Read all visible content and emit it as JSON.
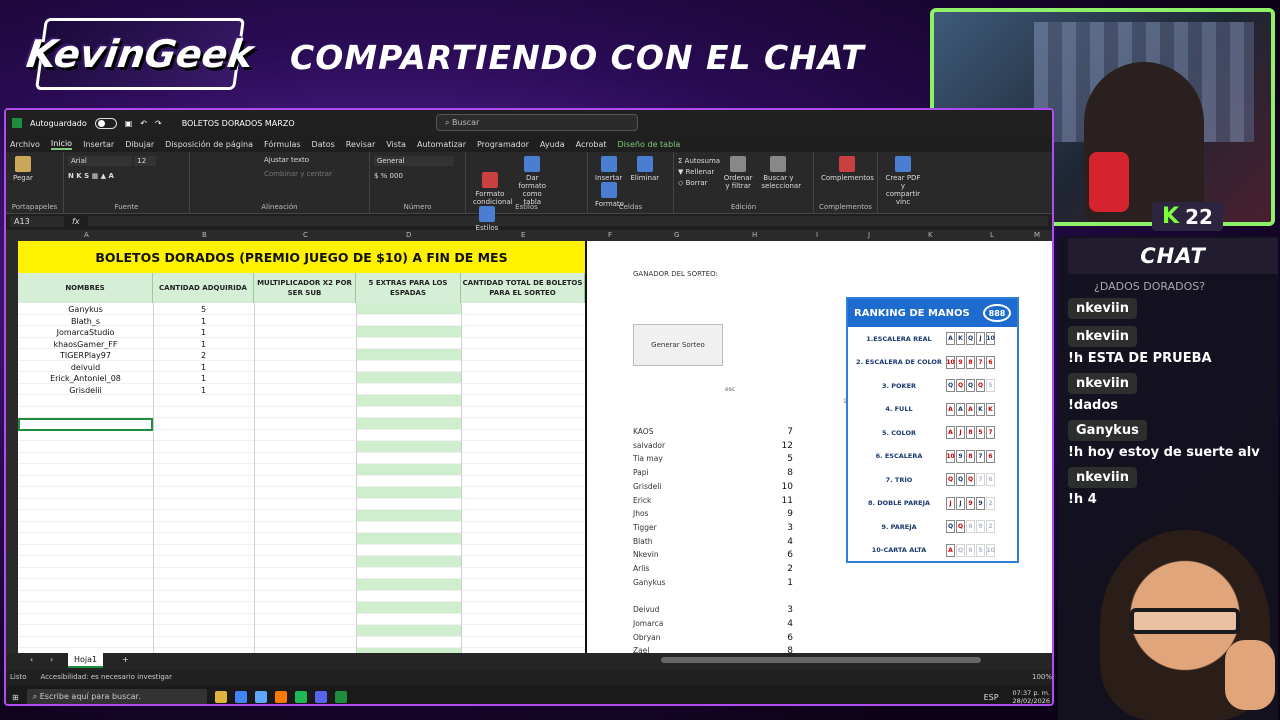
{
  "stream": {
    "logo_text": "KevinGeek",
    "title": "COMPARTIENDO CON EL CHAT",
    "viewers": "22",
    "chat_header": "CHAT"
  },
  "chat": [
    {
      "user": "nkeviin",
      "reply": "¿DADOS DORADOS?",
      "text": ""
    },
    {
      "user": "nkeviin",
      "reply": "",
      "text": "!h ESTA DE PRUEBA"
    },
    {
      "user": "nkeviin",
      "reply": "",
      "text": "!dados"
    },
    {
      "user": "Ganykus",
      "reply": "",
      "text": "!h hoy estoy de suerte alv"
    },
    {
      "user": "nkeviin",
      "reply": "",
      "text": "!h 4"
    }
  ],
  "excel": {
    "autosave": "Autoguardado",
    "filename": "BOLETOS DORADOS MARZO",
    "search": "Buscar",
    "menu": [
      "Archivo",
      "Inicio",
      "Insertar",
      "Dibujar",
      "Disposición de página",
      "Fórmulas",
      "Datos",
      "Revisar",
      "Vista",
      "Automatizar",
      "Programador",
      "Ayuda",
      "Acrobat",
      "Diseño de tabla"
    ],
    "ribbon": {
      "pegar": "Pegar",
      "portapapeles": "Portapapeles",
      "font": "Arial",
      "size": "12",
      "fuente": "Fuente",
      "ajustar": "Ajustar texto",
      "combinar": "Combinar y centrar",
      "alineacion": "Alineación",
      "general": "General",
      "numero": "Número",
      "formato_cond": "Formato condicional",
      "formato_tabla": "Dar formato como tabla",
      "estilos_celda": "Estilos de celda",
      "estilos": "Estilos",
      "insertar": "Insertar",
      "eliminar": "Eliminar",
      "formato": "Formato",
      "celdas": "Celdas",
      "autosuma": "Autosuma",
      "rellenar": "Rellenar",
      "borrar": "Borrar",
      "ordenar": "Ordenar y filtrar",
      "buscar": "Buscar y seleccionar",
      "edicion": "Edición",
      "complementos": "Complementos",
      "pdf": "Crear PDF y compartir vínc"
    },
    "cellref": "A13",
    "fx": "fx",
    "cols": [
      "A",
      "B",
      "C",
      "D",
      "E",
      "F",
      "G",
      "H",
      "I",
      "J",
      "K",
      "L",
      "M"
    ],
    "banner": "BOLETOS DORADOS (PREMIO JUEGO DE $10) A FIN DE MES",
    "headers": [
      "NOMBRES",
      "CANTIDAD ADQUIRIDA",
      "MULTIPLICADOR X2 POR SER SUB",
      "5 EXTRAS PARA LOS ESPADAS",
      "CANTIDAD TOTAL DE BOLETOS PARA EL SORTEO"
    ],
    "rows": [
      [
        "Ganykus",
        "5"
      ],
      [
        "Blath_s",
        "1"
      ],
      [
        "JomarcaStudio",
        "1"
      ],
      [
        "khaosGamer_FF",
        "1"
      ],
      [
        "TIGERPlay97",
        "2"
      ],
      [
        "deivuid",
        "1"
      ],
      [
        "Erick_Antoniel_08",
        "1"
      ],
      [
        "Grisdelii",
        "1"
      ]
    ],
    "ganador": "GANADOR DEL SORTEO:",
    "generar": "Generar Sorteo",
    "esc": "esc",
    "one": "1",
    "scores": [
      [
        "KAOS",
        "7"
      ],
      [
        "salvador",
        "12"
      ],
      [
        "Tia may",
        "5"
      ],
      [
        "Papi",
        "8"
      ],
      [
        "Grisdeli",
        "10"
      ],
      [
        "Erick",
        "11"
      ],
      [
        "Jhos",
        "9"
      ],
      [
        "Tigger",
        "3"
      ],
      [
        "Blath",
        "4"
      ],
      [
        "Nkevin",
        "6"
      ],
      [
        "Arlis",
        "2"
      ],
      [
        "Ganykus",
        "1"
      ],
      [
        "",
        ""
      ],
      [
        "Deivud",
        "3"
      ],
      [
        "Jomarca",
        "4"
      ],
      [
        "Obryan",
        "6"
      ],
      [
        "Zael",
        "8"
      ]
    ],
    "sheet_tab": "Hoja1",
    "status_listo": "Listo",
    "status_acc": "Accesibilidad: es necesario investigar",
    "zoom": "100%",
    "taskbar_search": "Escribe aquí para buscar.",
    "time": "07:37 p. m.",
    "date": "28/02/2026",
    "lang": "ESP"
  },
  "ranking": {
    "title": "RANKING DE MANOS",
    "chip": "888",
    "hands": [
      {
        "label": "1.ESCALERA REAL",
        "cards": [
          "A",
          "K",
          "Q",
          "J",
          "10"
        ],
        "red": [
          0,
          0,
          0,
          0,
          0
        ]
      },
      {
        "label": "2. ESCALERA DE COLOR",
        "cards": [
          "10",
          "9",
          "8",
          "7",
          "6"
        ],
        "red": [
          1,
          1,
          1,
          1,
          1
        ]
      },
      {
        "label": "3. POKER",
        "cards": [
          "Q",
          "Q",
          "Q",
          "Q",
          "5"
        ],
        "red": [
          0,
          1,
          0,
          1,
          2
        ]
      },
      {
        "label": "4. FULL",
        "cards": [
          "A",
          "A",
          "A",
          "K",
          "K"
        ],
        "red": [
          1,
          0,
          1,
          0,
          1
        ]
      },
      {
        "label": "5. COLOR",
        "cards": [
          "A",
          "J",
          "8",
          "5",
          "7"
        ],
        "red": [
          1,
          1,
          1,
          1,
          1
        ]
      },
      {
        "label": "6. ESCALERA",
        "cards": [
          "10",
          "9",
          "8",
          "7",
          "6"
        ],
        "red": [
          1,
          0,
          1,
          0,
          1
        ]
      },
      {
        "label": "7. TRÍO",
        "cards": [
          "Q",
          "Q",
          "Q",
          "7",
          "6"
        ],
        "red": [
          1,
          0,
          1,
          2,
          2
        ]
      },
      {
        "label": "8. DOBLE PAREJA",
        "cards": [
          "J",
          "J",
          "9",
          "9",
          "2"
        ],
        "red": [
          1,
          0,
          1,
          0,
          2
        ]
      },
      {
        "label": "9. PAREJA",
        "cards": [
          "Q",
          "Q",
          "6",
          "9",
          "2"
        ],
        "red": [
          0,
          1,
          2,
          2,
          2
        ]
      },
      {
        "label": "10-CARTA ALTA",
        "cards": [
          "A",
          "Q",
          "6",
          "5",
          "10"
        ],
        "red": [
          1,
          2,
          2,
          2,
          2
        ]
      }
    ]
  }
}
